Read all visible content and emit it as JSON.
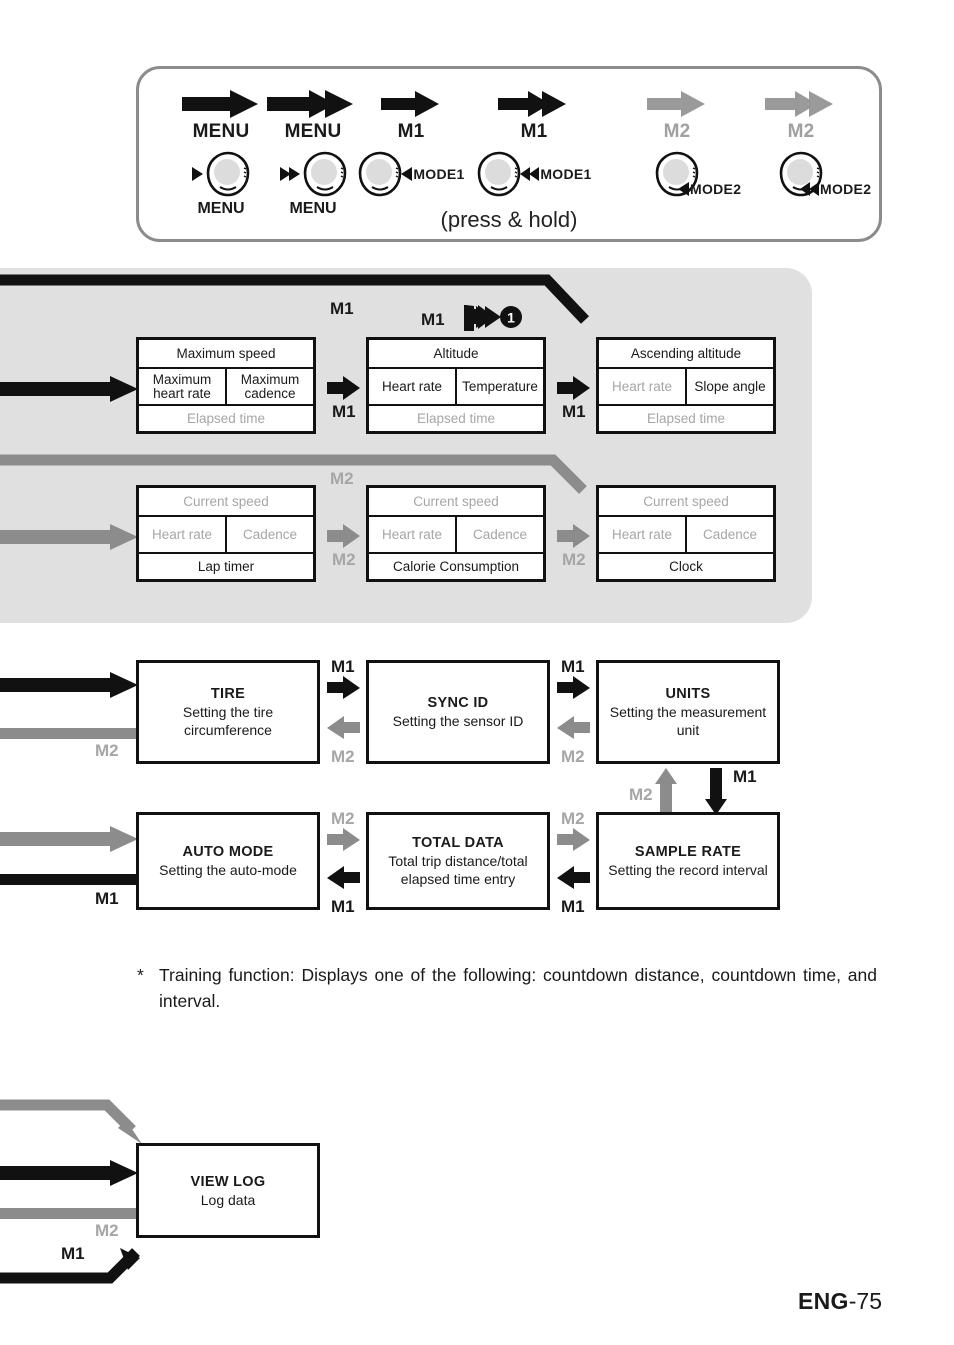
{
  "legend": {
    "press_hold": "(press & hold)",
    "items": [
      {
        "label": "MENU",
        "label_color": "#111111",
        "arrow": "single-arrow-black",
        "knob": "menu-knob",
        "knob_prefix": "single-play-marker",
        "knob_sub": "MENU",
        "mode_tag": ""
      },
      {
        "label": "MENU",
        "label_color": "#111111",
        "arrow": "double-arrow-black",
        "knob": "menu-knob",
        "knob_prefix": "double-play-marker",
        "knob_sub": "MENU",
        "mode_tag": ""
      },
      {
        "label": "M1",
        "label_color": "#111111",
        "arrow": "single-arrow-black",
        "knob": "mode1-knob",
        "knob_prefix": "",
        "knob_sub": "",
        "mode_tag": "MODE1",
        "mode_marker": "single"
      },
      {
        "label": "M1",
        "label_color": "#111111",
        "arrow": "double-arrow-black",
        "knob": "mode1-knob",
        "knob_prefix": "",
        "knob_sub": "",
        "mode_tag": "MODE1",
        "mode_marker": "double"
      },
      {
        "label": "M2",
        "label_color": "#a0a0a0",
        "arrow": "single-arrow-gray",
        "knob": "mode2-knob",
        "knob_prefix": "",
        "knob_sub": "",
        "mode_tag": "MODE2",
        "mode_marker": "single"
      },
      {
        "label": "M2",
        "label_color": "#a0a0a0",
        "arrow": "double-arrow-gray",
        "knob": "mode2-knob",
        "knob_prefix": "",
        "knob_sub": "",
        "mode_tag": "MODE2",
        "mode_marker": "double"
      }
    ]
  },
  "stage": {
    "m1_row": {
      "flow_labels": [
        "M1",
        "M1",
        "M1",
        "M1"
      ],
      "badge": "1",
      "screens": [
        {
          "top": "Maximum speed",
          "left": "Maximum heart rate",
          "right": "Maximum cadence",
          "bottom": "Elapsed time",
          "top_dim": false,
          "left_dim": false,
          "right_dim": false,
          "bottom_dim": true
        },
        {
          "top": "Altitude",
          "left": "Heart rate",
          "right": "Temperature",
          "bottom": "Elapsed time",
          "top_dim": false,
          "left_dim": false,
          "right_dim": false,
          "bottom_dim": true
        },
        {
          "top": "Ascending altitude",
          "left": "Heart rate",
          "right": "Slope angle",
          "bottom": "Elapsed time",
          "top_dim": false,
          "left_dim": true,
          "right_dim": false,
          "bottom_dim": true
        }
      ]
    },
    "m2_row": {
      "flow_labels": [
        "M2",
        "M2",
        "M2"
      ],
      "screens": [
        {
          "top": "Current speed",
          "left": "Heart rate",
          "right": "Cadence",
          "bottom": "Lap timer",
          "top_dim": true,
          "left_dim": true,
          "right_dim": true,
          "bottom_dim": false
        },
        {
          "top": "Current speed",
          "left": "Heart rate",
          "right": "Cadence",
          "bottom": "Calorie Consumption",
          "top_dim": true,
          "left_dim": true,
          "right_dim": true,
          "bottom_dim": false
        },
        {
          "top": "Current speed",
          "left": "Heart rate",
          "right": "Cadence",
          "bottom": "Clock",
          "top_dim": true,
          "left_dim": true,
          "right_dim": true,
          "bottom_dim": false
        }
      ]
    }
  },
  "settings": {
    "row1": [
      {
        "title": "TIRE",
        "desc": "Setting the tire circumference"
      },
      {
        "title": "SYNC ID",
        "desc": "Setting the sensor ID"
      },
      {
        "title": "UNITS",
        "desc": "Setting the measurement unit"
      }
    ],
    "row2": [
      {
        "title": "AUTO MODE",
        "desc": "Setting the auto-mode"
      },
      {
        "title": "TOTAL DATA",
        "desc": "Total trip distance/total elapsed time entry"
      },
      {
        "title": "SAMPLE RATE",
        "desc": "Setting the record interval"
      }
    ],
    "labels": {
      "m1": "M1",
      "m2": "M2"
    }
  },
  "viewlog": {
    "title": "VIEW LOG",
    "desc": "Log data",
    "m1": "M1",
    "m2": "M2"
  },
  "note": {
    "marker": "*",
    "text": "Training function: Displays one of the following: countdown distance, countdown time, and interval."
  },
  "footer": {
    "lang": "ENG",
    "sep": "-",
    "page": "75"
  },
  "colors": {
    "black": "#111111",
    "gray": "#8c8c8c",
    "light_gray_text": "#a6a6a6",
    "panel_bg": "#e0e0e0"
  }
}
